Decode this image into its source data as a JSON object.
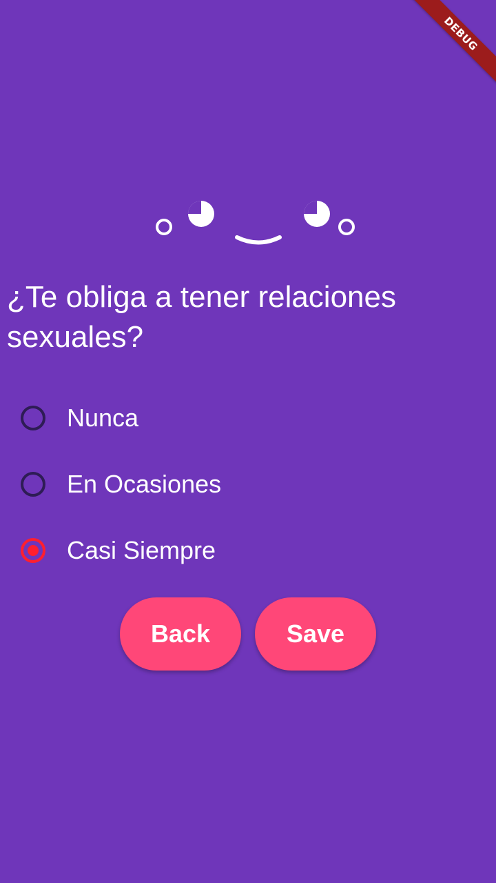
{
  "debug_banner": "DEBUG",
  "face_icon": "kaomoji-face-icon",
  "question": "¿Te obliga a tener relaciones sexuales?",
  "options": [
    {
      "label": "Nunca",
      "selected": false
    },
    {
      "label": "En Ocasiones",
      "selected": false
    },
    {
      "label": "Casi Siempre",
      "selected": true
    }
  ],
  "buttons": {
    "back_label": "Back",
    "save_label": "Save"
  },
  "colors": {
    "background": "#6f36ba",
    "button": "#ff4778",
    "radio_selected": "#ff1f2f",
    "radio_unselected": "#2e1c55"
  }
}
